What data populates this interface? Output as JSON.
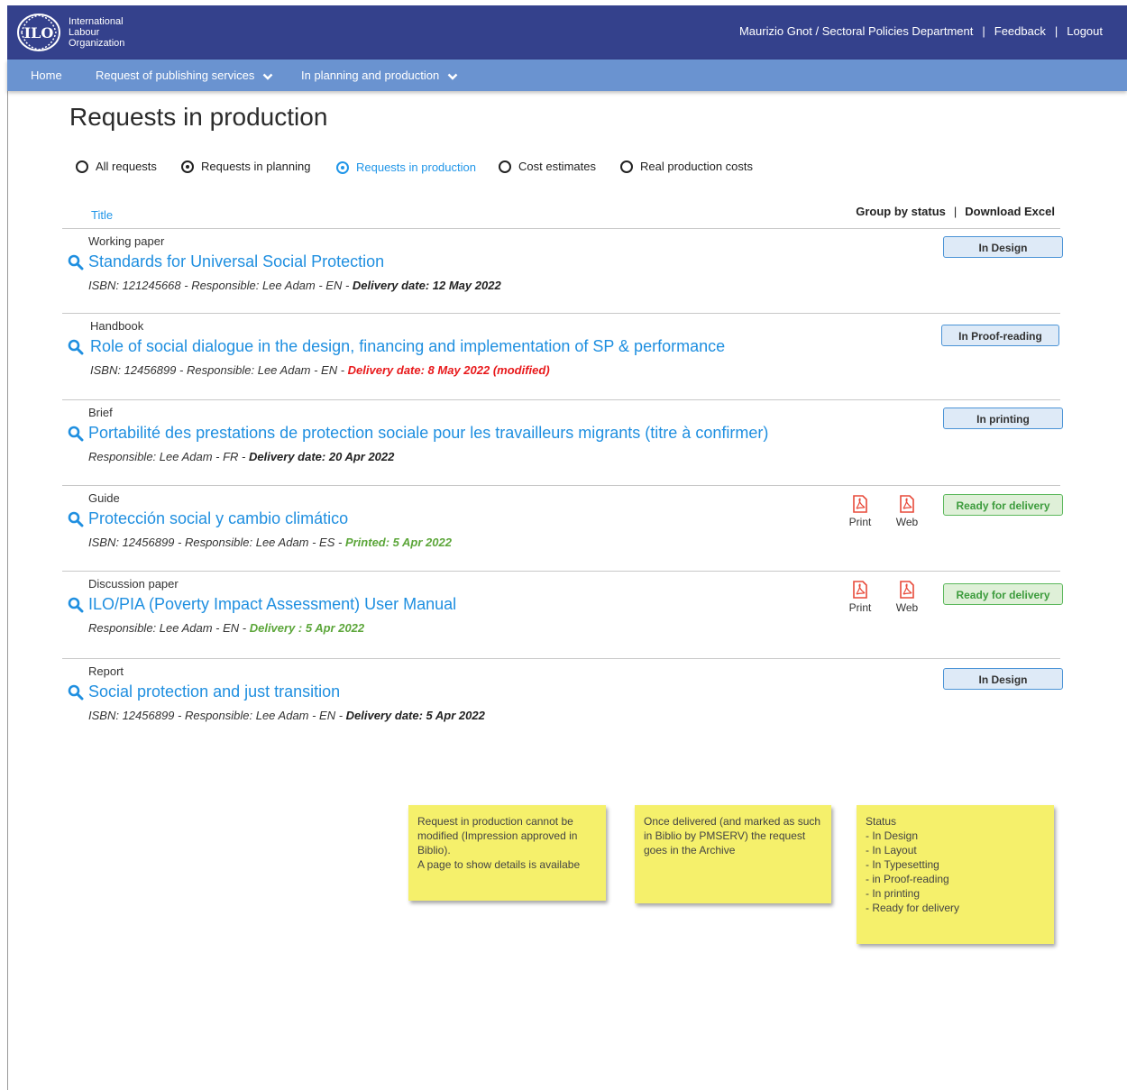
{
  "header": {
    "org_lines": [
      "International",
      "Labour",
      "Organization"
    ],
    "user": "Maurizio Gnot / Sectoral Policies Department",
    "feedback": "Feedback",
    "logout": "Logout",
    "separator": "|"
  },
  "nav": {
    "home": "Home",
    "publishing": "Request of publishing services",
    "planning": "In planning and production"
  },
  "page": {
    "title": "Requests in production",
    "filters": [
      {
        "label": "All requests",
        "state": "empty"
      },
      {
        "label": "Requests in planning",
        "state": "selected"
      },
      {
        "label": "Requests in production",
        "state": "active"
      },
      {
        "label": "Cost estimates",
        "state": "empty"
      },
      {
        "label": "Real production costs",
        "state": "empty"
      }
    ],
    "title_column": "Title",
    "group_by": "Group by status",
    "actions_separator": "|",
    "download": "Download Excel"
  },
  "requests": [
    {
      "kind": "Working paper",
      "title": "Standards for Universal Social Protection",
      "meta": "ISBN: 121245668 -  Responsible: Lee Adam - EN - ",
      "date": "Delivery date: 12 May 2022",
      "date_color": "black",
      "status": "In Design",
      "status_color": "blue"
    },
    {
      "kind": "Handbook",
      "title": "Role of social dialogue in the design, financing and implementation of SP & performance",
      "meta": "ISBN: 12456899 - Responsible: Lee Adam - EN - ",
      "date": "Delivery date: 8 May 2022 (modified)",
      "date_color": "red",
      "status": "In Proof-reading",
      "status_color": "blue"
    },
    {
      "kind": "Brief",
      "title": "Portabilité des prestations de protection sociale pour les travailleurs migrants (titre à confirmer)",
      "meta": "Responsible: Lee Adam - FR - ",
      "date": "Delivery date: 20 Apr 2022",
      "date_color": "black",
      "status": "In printing",
      "status_color": "blue"
    },
    {
      "kind": "Guide",
      "title": "Protección social y cambio climático",
      "meta": "ISBN: 12456899 - Responsible: Lee Adam - ES - ",
      "date": "Printed: 5 Apr 2022",
      "date_color": "green",
      "status": "Ready for delivery",
      "status_color": "green",
      "files": [
        "Print",
        "Web"
      ]
    },
    {
      "kind": "Discussion paper",
      "title": "ILO/PIA (Poverty Impact Assessment) User Manual",
      "meta": "Responsible: Lee Adam - EN - ",
      "date": "Delivery : 5 Apr 2022",
      "date_color": "green",
      "status": "Ready for delivery",
      "status_color": "green",
      "files": [
        "Print",
        "Web"
      ]
    },
    {
      "kind": "Report",
      "title": "Social protection and just transition",
      "meta": "ISBN: 12456899 - Responsible: Lee Adam - EN - ",
      "date": "Delivery date: 5 Apr 2022",
      "date_color": "black",
      "status": "In Design",
      "status_color": "blue"
    }
  ],
  "notes": [
    "Request in production cannot be modified (Impression approved in Biblio).\nA page to show details is availabe",
    "Once delivered (and marked as such in Biblio by PMSERV) the request goes in the Archive",
    "Status\n-  In Design\n- In Layout\n- In Typesetting\n- in Proof-reading\n- In printing\n- Ready for delivery"
  ],
  "colors": {
    "header_bg": "#34418c",
    "nav_bg": "#6a93d0",
    "link": "#1f8fe0",
    "date_red": "#e8191b",
    "date_green": "#5ca63a",
    "note_bg": "#f5f06b",
    "pdf_icon": "#e84a3a"
  },
  "icons": {
    "logo": "ilo-logo-icon",
    "search": "search-icon",
    "chevron": "chevron-down-icon",
    "file": "pdf-file-icon"
  }
}
